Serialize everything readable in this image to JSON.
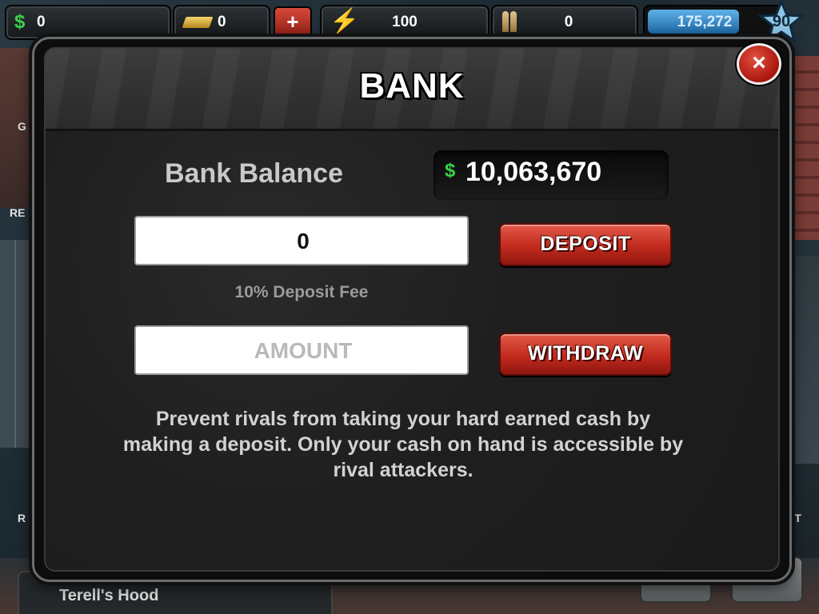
{
  "hud": {
    "cash": "0",
    "gold": "0",
    "add_label": "+",
    "energy": "100",
    "ammo": "0",
    "xp": "175,272",
    "xp_fill_fraction": 0.72,
    "level": "90"
  },
  "modal": {
    "title": "BANK",
    "close_label": "×",
    "balance_label": "Bank Balance",
    "balance_currency": "$",
    "balance_value": "10,063,670",
    "deposit_input_value": "0",
    "deposit_button": "DEPOSIT",
    "fee_label": "10% Deposit Fee",
    "withdraw_placeholder": "AMOUNT",
    "withdraw_button": "WITHDRAW",
    "info_text": "Prevent rivals from taking your hard earned cash by making a deposit. Only your cash on hand is accessible by rival attackers."
  },
  "footer": {
    "hood_name": "Terell's Hood"
  },
  "background_labels": {
    "left_1": "G",
    "left_2": "RE",
    "left_3": "R",
    "right_1": "ST"
  },
  "colors": {
    "cash_green": "#3bd14a",
    "button_red": "#c12a1d",
    "xp_blue": "#1d6aa6"
  },
  "icons": [
    "cash-icon",
    "gold-bar-icon",
    "energy-bolt-icon",
    "ammo-icon",
    "level-star-icon",
    "close-icon"
  ]
}
